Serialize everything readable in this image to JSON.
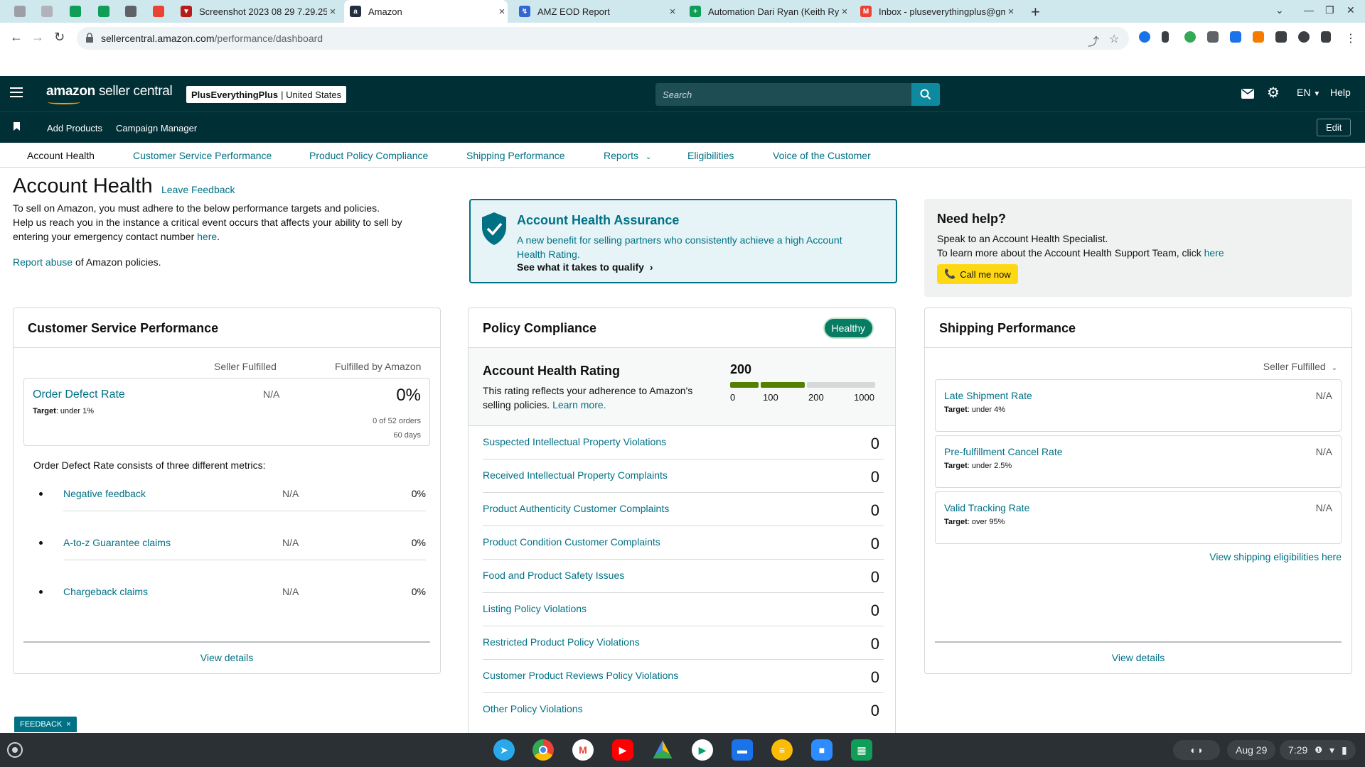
{
  "browser": {
    "tabs": [
      {
        "title": "Screenshot 2023 08 29 7.29.25",
        "icon_color": "#b71c1c"
      },
      {
        "title": "Amazon",
        "icon_color": "#232f3e",
        "active": true
      },
      {
        "title": "AMZ EOD Report",
        "icon_color": "#3367d6"
      },
      {
        "title": "Automation Dari Ryan (Keith Ry",
        "icon_color": "#0f9d58"
      },
      {
        "title": "Inbox - pluseverythingplus@gm",
        "icon_color": "#ea4335"
      }
    ],
    "url_host": "sellercentral.amazon.com",
    "url_path": "/performance/dashboard"
  },
  "header": {
    "logo_amazon": "amazon",
    "logo_rest": "seller central",
    "merchant_name": "PlusEverythingPlus",
    "marketplace": "| United States",
    "search_placeholder": "Search",
    "language": "EN",
    "help": "Help"
  },
  "subnav": {
    "links": [
      "Add Products",
      "Campaign Manager"
    ],
    "edit": "Edit"
  },
  "perf_tabs": [
    "Account Health",
    "Customer Service Performance",
    "Product Policy Compliance",
    "Shipping Performance",
    "Reports",
    "Eligibilities",
    "Voice of the Customer"
  ],
  "page": {
    "title": "Account Health",
    "leave_feedback": "Leave Feedback",
    "intro_line1": "To sell on Amazon, you must adhere to the below performance targets and policies.",
    "intro_line2": "Help us reach you in the instance a critical event occurs that affects your ability to sell by",
    "intro_line3": "entering your emergency contact number",
    "intro_here": "here",
    "report_abuse": "Report abuse",
    "report_abuse_rest": "of Amazon policies."
  },
  "assurance": {
    "title": "Account Health Assurance",
    "description": "A new benefit for selling partners who consistently achieve a high Account Health Rating.",
    "qualify": "See what it takes to qualify"
  },
  "help_box": {
    "title": "Need help?",
    "line1": "Speak to an Account Health Specialist.",
    "line2": "To learn more about the Account Health Support Team, click",
    "here": "here",
    "call": "Call me now"
  },
  "customer_service": {
    "title": "Customer Service Performance",
    "col_seller": "Seller Fulfilled",
    "col_fba": "Fulfilled by Amazon",
    "odr": {
      "name": "Order Defect Rate",
      "target_label": "Target",
      "target": ": under 1%",
      "seller": "N/A",
      "fba": "0%",
      "orders": "0 of 52 orders",
      "period": "60 days"
    },
    "consists": "Order Defect Rate consists of three different metrics:",
    "metrics": [
      {
        "name": "Negative feedback",
        "seller": "N/A",
        "fba": "0%"
      },
      {
        "name": "A-to-z Guarantee claims",
        "seller": "N/A",
        "fba": "0%"
      },
      {
        "name": "Chargeback claims",
        "seller": "N/A",
        "fba": "0%"
      }
    ],
    "view_details": "View details"
  },
  "policy": {
    "title": "Policy Compliance",
    "status": "Healthy",
    "ahr_title": "Account Health Rating",
    "ahr_desc": "This rating reflects your adherence to Amazon's selling policies.",
    "learn_more": "Learn more.",
    "score": 200,
    "scale": [
      "0",
      "100",
      "200",
      "1000"
    ],
    "violations": [
      {
        "name": "Suspected Intellectual Property Violations",
        "count": "0"
      },
      {
        "name": "Received Intellectual Property Complaints",
        "count": "0"
      },
      {
        "name": "Product Authenticity Customer Complaints",
        "count": "0"
      },
      {
        "name": "Product Condition Customer Complaints",
        "count": "0"
      },
      {
        "name": "Food and Product Safety Issues",
        "count": "0"
      },
      {
        "name": "Listing Policy Violations",
        "count": "0"
      },
      {
        "name": "Restricted Product Policy Violations",
        "count": "0"
      },
      {
        "name": "Customer Product Reviews Policy Violations",
        "count": "0"
      },
      {
        "name": "Other Policy Violations",
        "count": "0"
      }
    ]
  },
  "shipping": {
    "title": "Shipping Performance",
    "selector": "Seller Fulfilled",
    "metrics": [
      {
        "name": "Late Shipment Rate",
        "target_label": "Target",
        "target": ": under 4%",
        "value": "N/A"
      },
      {
        "name": "Pre-fulfillment Cancel Rate",
        "target_label": "Target",
        "target": ": under 2.5%",
        "value": "N/A"
      },
      {
        "name": "Valid Tracking Rate",
        "target_label": "Target",
        "target": ": over 95%",
        "value": "N/A"
      }
    ],
    "eligibilities": "View shipping eligibilities here",
    "view_details": "View details"
  },
  "feedback_tab": "FEEDBACK",
  "taskbar": {
    "date": "Aug 29",
    "time": "7:29"
  }
}
